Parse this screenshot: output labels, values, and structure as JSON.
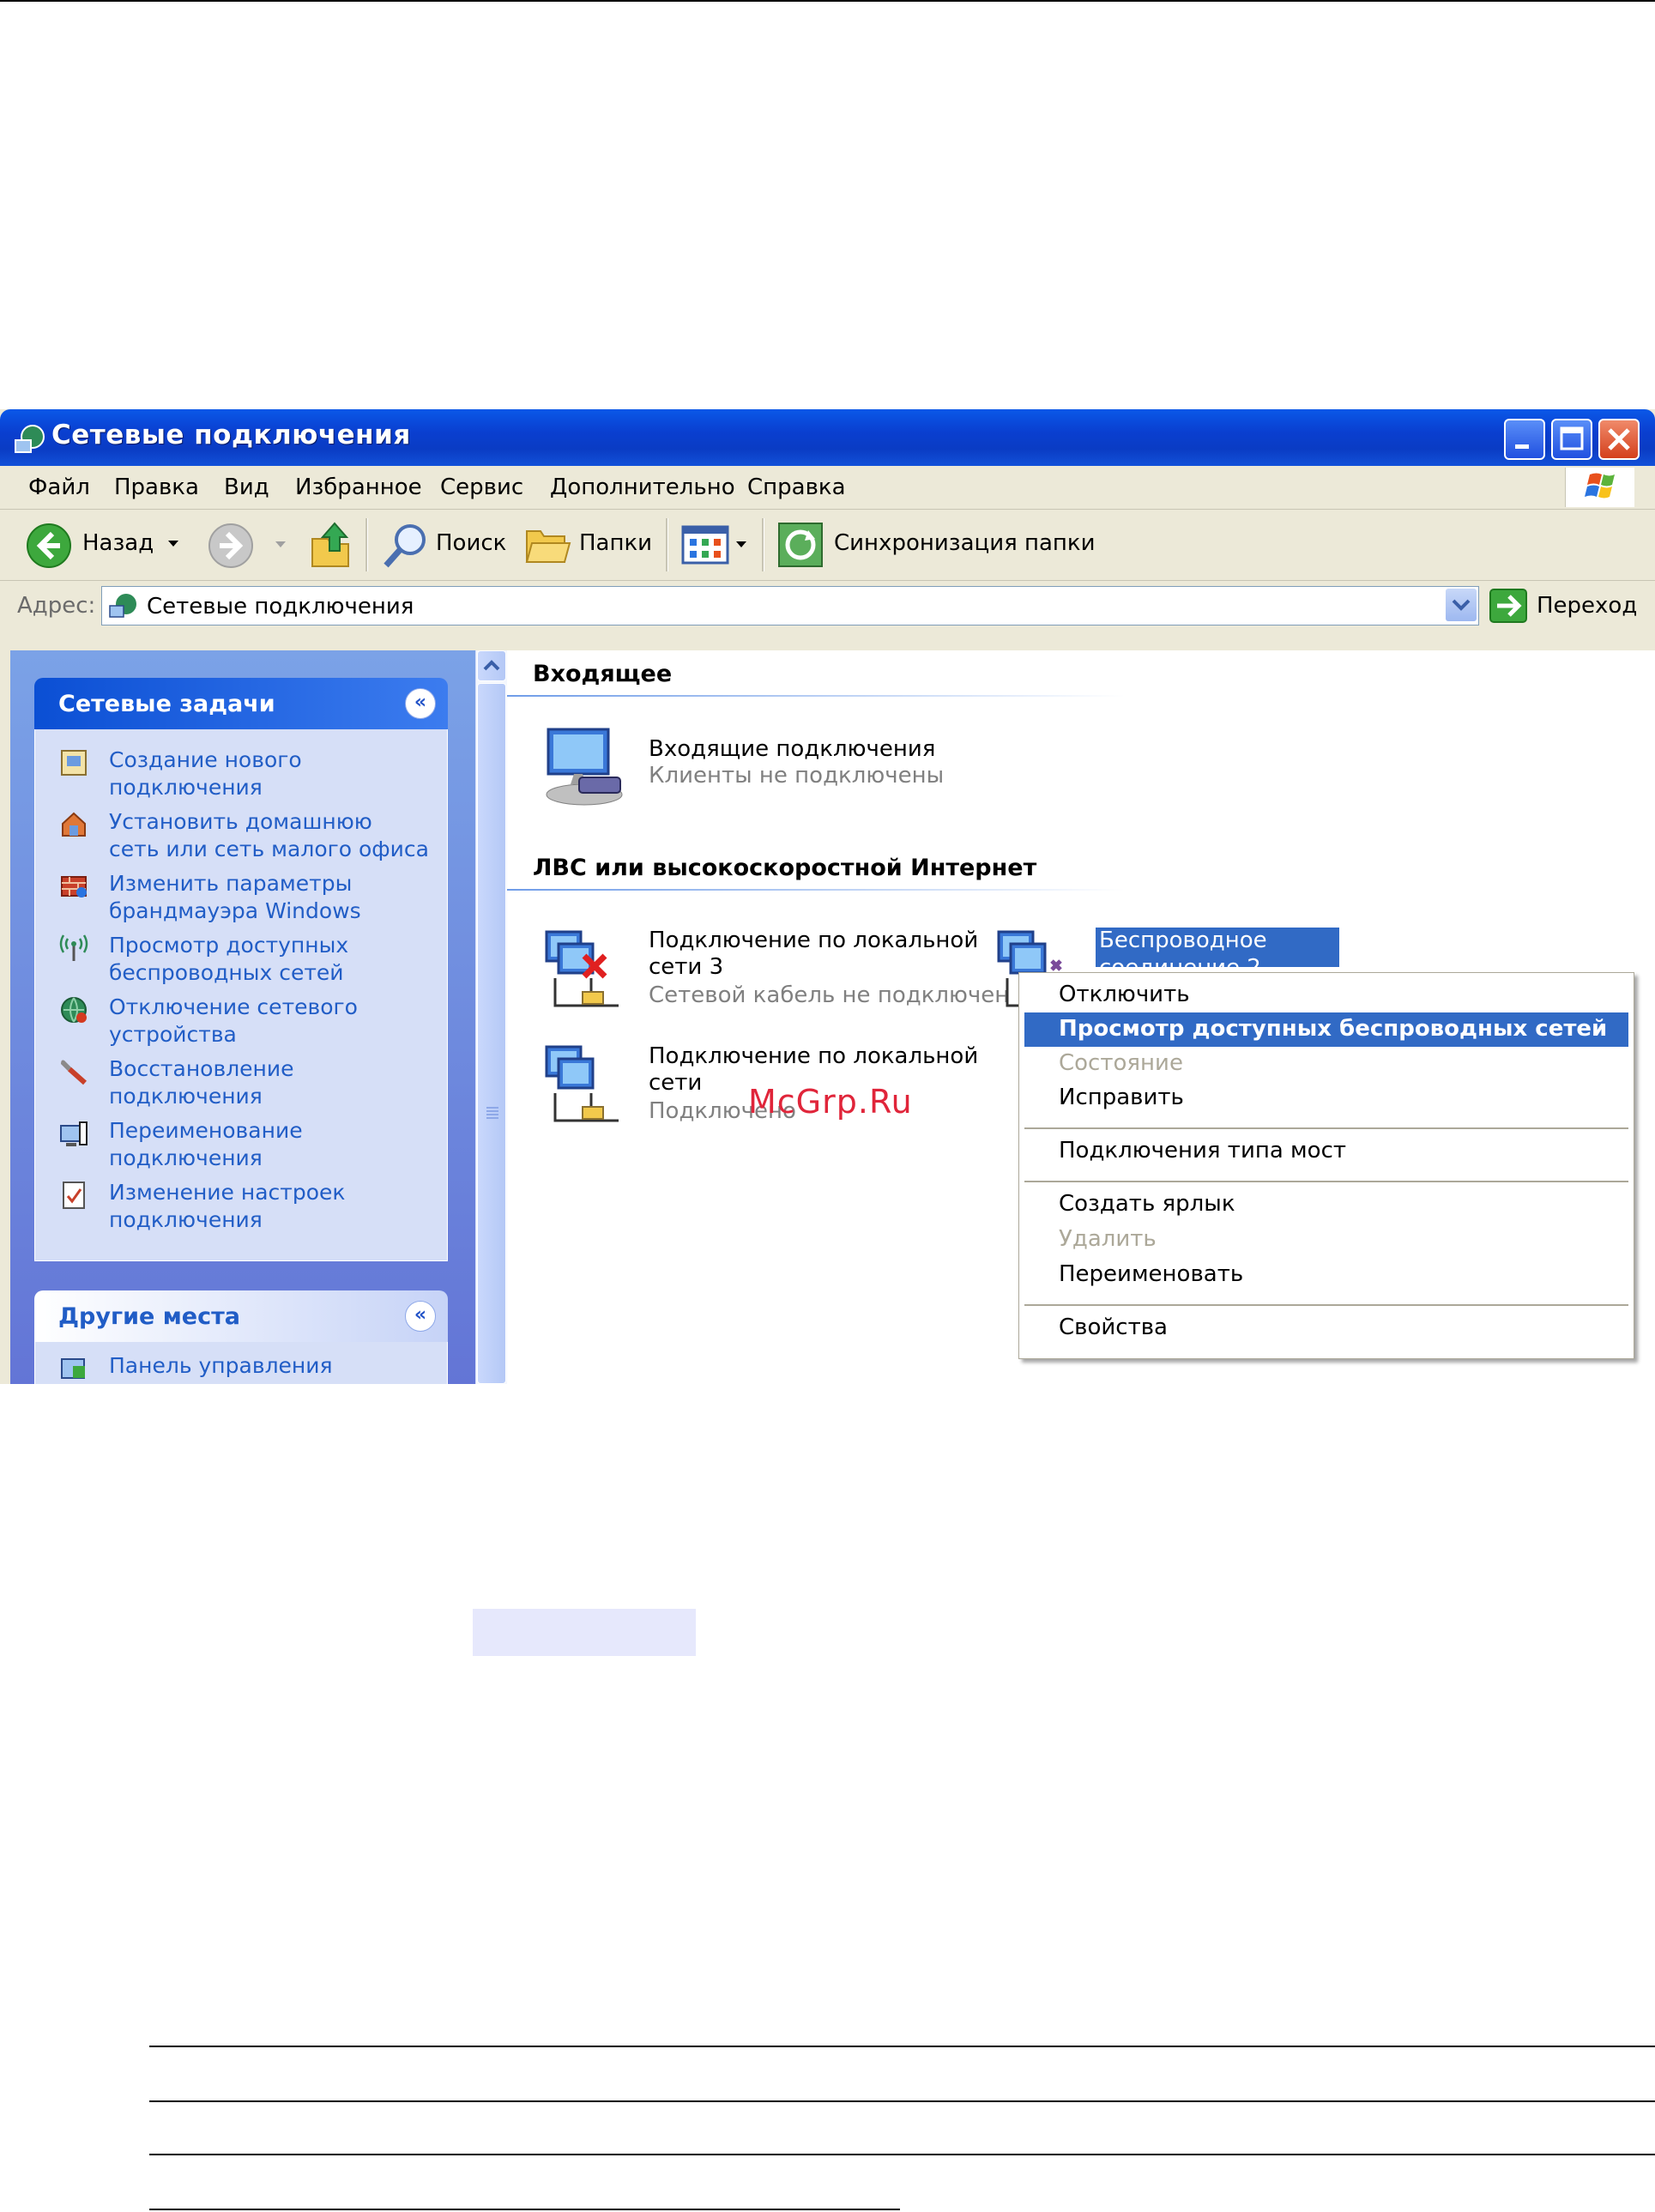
{
  "window": {
    "title": "Сетевые подключения"
  },
  "menu": [
    "Файл",
    "Правка",
    "Вид",
    "Избранное",
    "Сервис",
    "Дополнительно",
    "Справка"
  ],
  "toolbar": {
    "back": "Назад",
    "search": "Поиск",
    "folders": "Папки",
    "sync": "Синхронизация папки"
  },
  "address": {
    "label": "Адрес:",
    "value": "Сетевые подключения",
    "go": "Переход"
  },
  "task_pane": {
    "network_tasks": {
      "title": "Сетевые задачи",
      "items": [
        {
          "line1": "Создание нового",
          "line2": "подключения"
        },
        {
          "line1": "Установить домашнюю",
          "line2": "сеть или сеть малого офиса"
        },
        {
          "line1": "Изменить параметры",
          "line2": "брандмауэра Windows"
        },
        {
          "line1": "Просмотр доступных",
          "line2": "беспроводных сетей"
        },
        {
          "line1": "Отключение сетевого",
          "line2": "устройства"
        },
        {
          "line1": "Восстановление",
          "line2": "подключения"
        },
        {
          "line1": "Переименование",
          "line2": "подключения"
        },
        {
          "line1": "Изменение настроек",
          "line2": "подключения"
        }
      ]
    },
    "other_places": {
      "title": "Другие места",
      "items": [
        {
          "line1": "Панель управления"
        }
      ]
    }
  },
  "content": {
    "incoming": {
      "header": "Входящее",
      "item": {
        "title": "Входящие подключения",
        "status": "Клиенты не подключены"
      }
    },
    "lan": {
      "header": "ЛВС или высокоскоростной Интернет",
      "items": [
        {
          "line1": "Подключение по локальной",
          "line2": "сети 3",
          "status": "Сетевой кабель не подключен"
        },
        {
          "line1": "Беспроводное сетевое",
          "line2": "соединение 2"
        },
        {
          "line1": "Подключение по локальной",
          "line2": "сети",
          "status": "Подключено"
        }
      ]
    }
  },
  "context_menu": {
    "items": [
      {
        "label": "Отключить",
        "state": "normal"
      },
      {
        "label": "Просмотр доступных беспроводных сетей",
        "state": "highlighted"
      },
      {
        "label": "Состояние",
        "state": "disabled"
      },
      {
        "label": "Исправить",
        "state": "normal"
      },
      {
        "label": "Подключения типа мост",
        "state": "normal"
      },
      {
        "label": "Создать ярлык",
        "state": "normal"
      },
      {
        "label": "Удалить",
        "state": "disabled"
      },
      {
        "label": "Переименовать",
        "state": "normal"
      },
      {
        "label": "Свойства",
        "state": "normal"
      }
    ]
  },
  "watermark": "McGrp.Ru",
  "colors": {
    "title_bar": "#0A3FD0",
    "task_link": "#215DC6",
    "selection": "#316AC5",
    "disabled": "#ACA899",
    "watermark": "#E0253A"
  }
}
